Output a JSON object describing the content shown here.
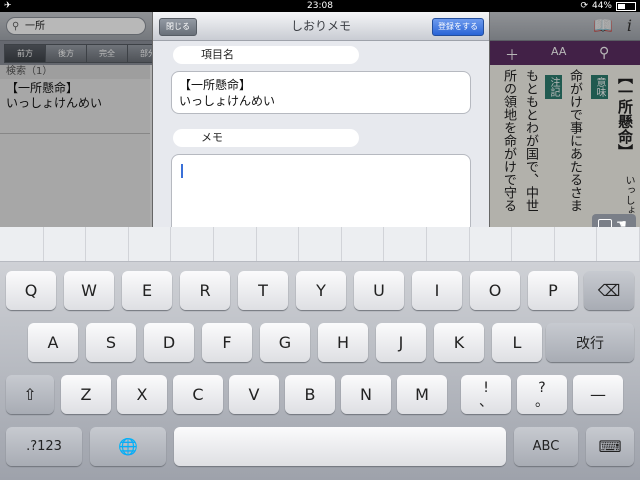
{
  "status_bar": {
    "time": "23:08",
    "battery": "44%",
    "battery_level": 0.44
  },
  "app": {
    "search_value": "一所",
    "scope_tabs": [
      "前方",
      "後方",
      "完全",
      "部分"
    ],
    "results_header": "検索（1）",
    "result_items": [
      "【一所懸命】",
      "いっしょけんめい"
    ],
    "vertical_text": {
      "heading": "【一所懸命】",
      "reading": "いっしょ",
      "tag_meaning": "意味",
      "tag_note": "注記",
      "lines": [
        "命がけで事にあたるさま",
        "もともとわが国で、中世",
        "所の領地を命がけで守る"
      ]
    }
  },
  "popover": {
    "close_label": "閉じる",
    "title": "しおりメモ",
    "save_label": "登録をする",
    "item_name_label": "項目名",
    "item_name_value": [
      "【一所懸命】",
      "いっしょけんめい"
    ],
    "memo_label": "メモ",
    "memo_value": ""
  },
  "keyboard": {
    "row1": [
      "Q",
      "W",
      "E",
      "R",
      "T",
      "Y",
      "U",
      "I",
      "O",
      "P"
    ],
    "row2": [
      "A",
      "S",
      "D",
      "F",
      "G",
      "H",
      "J",
      "K",
      "L"
    ],
    "return_label": "改行",
    "row3": [
      "Z",
      "X",
      "C",
      "V",
      "B",
      "N",
      "M"
    ],
    "punct1": [
      "!",
      "、"
    ],
    "punct2": [
      "?",
      "。"
    ],
    "dash": "—",
    "numbers_label": ".?123",
    "abc_label": "ABC"
  }
}
